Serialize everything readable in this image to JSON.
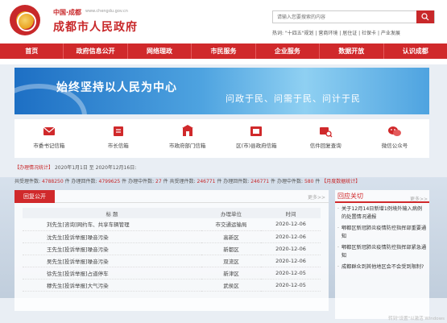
{
  "header": {
    "site_top": "中国·成都",
    "site_url": "www.chengdu.gov.cn",
    "site_name": "成都市人民政府"
  },
  "search": {
    "placeholder": "请输入您要搜索的内容"
  },
  "hot": {
    "label": "热词:",
    "items": [
      "\"十四五\"规划",
      "营商环境",
      "居住证",
      "社保卡",
      "产业发展"
    ]
  },
  "nav": {
    "items": [
      "首页",
      "政府信息公开",
      "网络理政",
      "市民服务",
      "企业服务",
      "数据开放",
      "认识成都"
    ]
  },
  "banner": {
    "slogan": "始终坚持以人民为中心",
    "subslogan": "问政于民、问需于民、问计于民"
  },
  "services": [
    {
      "label": "市委书记信箱",
      "icon": "mail-icon"
    },
    {
      "label": "市长信箱",
      "icon": "letter-icon"
    },
    {
      "label": "市政府部门信箱",
      "icon": "building-mail-icon"
    },
    {
      "label": "区(市)县政府信箱",
      "icon": "region-mail-icon"
    },
    {
      "label": "信件回复查询",
      "icon": "search-mail-icon"
    },
    {
      "label": "微信公众号",
      "icon": "wechat-icon"
    }
  ],
  "stats": {
    "label": "【办理情况统计】",
    "period": "2020年1月1日 至 2020年12月16日:",
    "line": {
      "accepted_label": "共受理件数:",
      "accepted": "4788250",
      "accepted_unit": "件",
      "handled_label": "办理回件数:",
      "handled": "4799625",
      "handled_unit": "件",
      "processing_label": "办理中件数:",
      "processing": "27",
      "processing_unit": "件",
      "publish_label": "共受理件数:",
      "publish": "246771",
      "publish_unit": "件",
      "reply_label": "办理回件数:",
      "reply": "246771",
      "reply_unit": "件",
      "pending_label": "办理中件数:",
      "pending": "580",
      "pending_unit": "件",
      "monthly": "【月度数据统计】"
    }
  },
  "reply_panel": {
    "tab": "回复公开",
    "more": "更多>>",
    "columns": [
      "标 题",
      "办理单位",
      "时间"
    ],
    "rows": [
      {
        "title": "刘先生[咨询]网约车、共享车辆管理",
        "unit": "市交通运输局",
        "date": "2020-12-06"
      },
      {
        "title": "沈先生[投诉举报]噪音污染",
        "unit": "高新区",
        "date": "2020-12-06"
      },
      {
        "title": "王先生[投诉举报]噪音污染",
        "unit": "新都区",
        "date": "2020-12-06"
      },
      {
        "title": "吴先生[投诉举报]噪音污染",
        "unit": "双流区",
        "date": "2020-12-06"
      },
      {
        "title": "徐先生[投诉举报]占道停车",
        "unit": "新津区",
        "date": "2020-12-05"
      },
      {
        "title": "穆先生[投诉举报]大气污染",
        "unit": "武侯区",
        "date": "2020-12-05"
      }
    ]
  },
  "focus_panel": {
    "title": "回应关切",
    "more": "更多>>",
    "items": [
      "关于12月14日新增1例境外输入病例的处置情况通报",
      "郫都区新冠肺炎疫情防控指挥部重要通知",
      "郫都区新冠肺炎疫情防控指挥部紧急通知",
      "成都群众到其他地区会不会受到限制?"
    ]
  },
  "watermark": "转到\"设置\"以激活 Windows",
  "colors": {
    "brand": "#d0292b",
    "accent": "#c8282a"
  }
}
